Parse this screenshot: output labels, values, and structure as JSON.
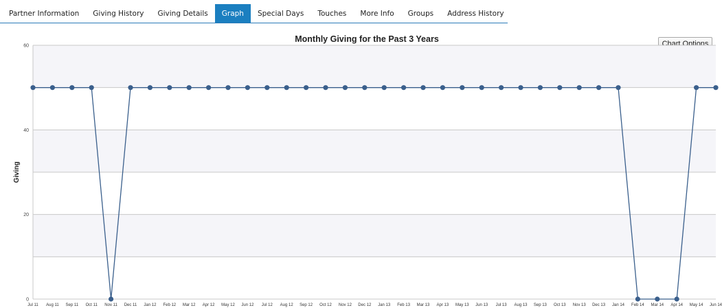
{
  "tabs": [
    {
      "label": "Partner Information",
      "active": false
    },
    {
      "label": "Giving History",
      "active": false
    },
    {
      "label": "Giving Details",
      "active": false
    },
    {
      "label": "Graph",
      "active": true
    },
    {
      "label": "Special Days",
      "active": false
    },
    {
      "label": "Touches",
      "active": false
    },
    {
      "label": "More Info",
      "active": false
    },
    {
      "label": "Groups",
      "active": false
    },
    {
      "label": "Address History",
      "active": false
    }
  ],
  "chart_options_label": "Chart Options",
  "colors": {
    "accent": "#1b7fc0",
    "series": "#3a5f8c",
    "band": "#f5f5f9"
  },
  "chart_data": {
    "type": "line",
    "title": "Monthly Giving for the Past 3 Years",
    "xlabel": "",
    "ylabel": "Giving",
    "ylim": [
      0,
      60
    ],
    "yticks": [
      0,
      20,
      40,
      60
    ],
    "grid": true,
    "categories": [
      "Jul 11",
      "Aug 11",
      "Sep 11",
      "Oct 11",
      "Nov 11",
      "Dec 11",
      "Jan 12",
      "Feb 12",
      "Mar 12",
      "Apr 12",
      "May 12",
      "Jun 12",
      "Jul 12",
      "Aug 12",
      "Sep 12",
      "Oct 12",
      "Nov 12",
      "Dec 12",
      "Jan 13",
      "Feb 13",
      "Mar 13",
      "Apr 13",
      "May 13",
      "Jun 13",
      "Jul 13",
      "Aug 13",
      "Sep 13",
      "Oct 13",
      "Nov 13",
      "Dec 13",
      "Jan 14",
      "Feb 14",
      "Mar 14",
      "Apr 14",
      "May 14",
      "Jun 14"
    ],
    "series": [
      {
        "values": [
          50,
          50,
          50,
          50,
          0,
          50,
          50,
          50,
          50,
          50,
          50,
          50,
          50,
          50,
          50,
          50,
          50,
          50,
          50,
          50,
          50,
          50,
          50,
          50,
          50,
          50,
          50,
          50,
          50,
          50,
          50,
          0,
          0,
          0,
          50,
          50
        ]
      }
    ]
  }
}
